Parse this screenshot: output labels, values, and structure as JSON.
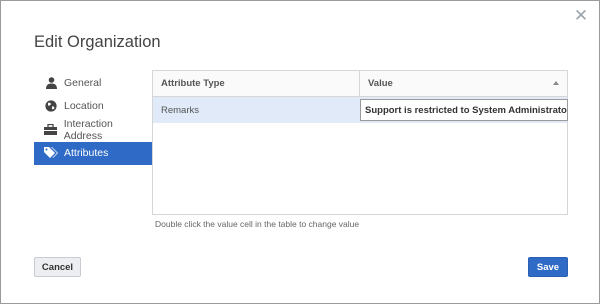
{
  "dialog": {
    "title": "Edit Organization",
    "close_glyph": "✕"
  },
  "sidebar": {
    "items": [
      {
        "label": "General",
        "icon": "user-icon",
        "active": false
      },
      {
        "label": "Location",
        "icon": "globe-icon",
        "active": false
      },
      {
        "label": "Interaction Address",
        "icon": "briefcase-icon",
        "active": false
      },
      {
        "label": "Attributes",
        "icon": "tags-icon",
        "active": true
      }
    ]
  },
  "table": {
    "columns": [
      "Attribute Type",
      "Value"
    ],
    "rows": [
      {
        "type": "Remarks",
        "value": "Support is restricted to System Administrator"
      }
    ],
    "hint": "Double click the value cell in the table to change value"
  },
  "buttons": {
    "cancel": "Cancel",
    "save": "Save"
  },
  "colors": {
    "accent": "#2e6ac6",
    "selected_row": "#e0eaf8"
  }
}
